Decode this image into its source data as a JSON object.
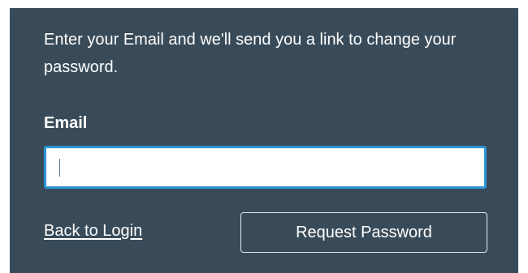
{
  "form": {
    "instructions": "Enter your Email and we'll send you a link to change your password.",
    "email_label": "Email",
    "email_value": "",
    "email_placeholder": "",
    "back_link_label": "Back to Login",
    "request_button_label": "Request Password"
  },
  "colors": {
    "panel_background": "#394b59",
    "input_focus_border": "#2b95d6",
    "text": "#ffffff"
  }
}
